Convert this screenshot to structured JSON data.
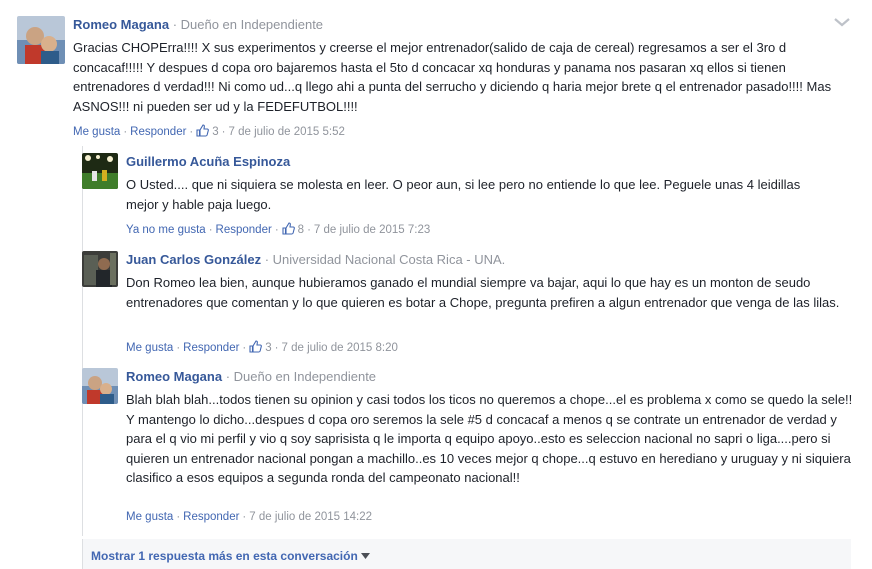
{
  "comments": [
    {
      "author": "Romeo Magana",
      "meta": " · Dueño en Independiente",
      "text": "Gracias CHOPErra!!!! X sus experimentos y creerse el mejor entrenador(salido de caja de cereal) regresamos a ser el 3ro d concacaf!!!!! Y despues d copa oro bajaremos hasta el 5to d concacar xq honduras y panama nos pasaran xq ellos si tienen entrenadores d verdad!!! Ni como ud...q llego ahi a punta del serrucho y diciendo q haria mejor brete q el entrenador pasado!!!! Mas ASNOS!!! ni pueden ser ud y la FEDEFUTBOL!!!!",
      "like_label": "Me gusta",
      "reply_label": "Responder",
      "likes": "3",
      "date": "7 de julio de 2015 5:52"
    }
  ],
  "replies": [
    {
      "author": "Guillermo Acuña Espinoza",
      "meta": "",
      "text": "O Usted.... que ni siquiera se molesta en leer. O peor aun, si lee pero no entiende lo que lee. Peguele unas 4 leidillas mejor y hable paja luego.",
      "like_label": "Ya no me gusta",
      "reply_label": "Responder",
      "likes": "8",
      "date": "7 de julio de 2015 7:23"
    },
    {
      "author": "Juan Carlos González",
      "meta": " · Universidad Nacional Costa Rica - UNA.",
      "text": "Don Romeo lea bien, aunque hubieramos ganado el mundial siempre va bajar, aqui lo que hay es un monton de seudo entrenadores que comentan y lo que quieren es botar a Chope, pregunta prefiren a algun entrenador que venga de las lilas.",
      "like_label": "Me gusta",
      "reply_label": "Responder",
      "likes": "3",
      "date": "7 de julio de 2015 8:20"
    },
    {
      "author": "Romeo Magana",
      "meta": " · Dueño en Independiente",
      "text": "Blah blah blah...todos tienen su opinion y casi todos los ticos no queremos a chope...el es problema x como se quedo la sele!! Y mantengo lo dicho...despues d copa oro seremos la sele #5 d concacaf a menos q se contrate un entrenador de verdad y para el q vio mi perfil y vio q soy saprisista q le importa q equipo apoyo..esto es seleccion nacional no sapri o liga....pero si quieren un entrenador nacional pongan a machillo..es 10 veces mejor q chope...q estuvo en herediano y uruguay y ni siquiera clasifico a esos equipos a segunda ronda del campeonato nacional!!",
      "like_label": "Me gusta",
      "reply_label": "Responder",
      "likes": "",
      "date": "7 de julio de 2015 14:22"
    }
  ],
  "more_replies_label": "Mostrar 1 respuesta más en esta conversación",
  "colors": {
    "link": "#365899",
    "action": "#4267b2",
    "meta": "#90949c"
  }
}
